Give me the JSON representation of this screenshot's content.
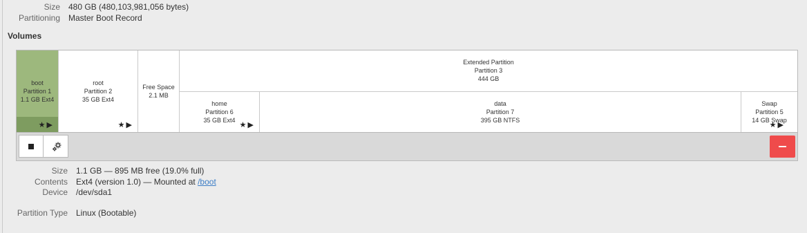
{
  "disk_info": {
    "size_label": "Size",
    "size_value": "480 GB (480,103,981,056 bytes)",
    "partitioning_label": "Partitioning",
    "partitioning_value": "Master Boot Record"
  },
  "volumes": {
    "title": "Volumes",
    "segments": [
      {
        "line1": "boot",
        "line2": "Partition 1",
        "line3": "1.1 GB Ext4",
        "selected": true
      },
      {
        "line1": "root",
        "line2": "Partition 2",
        "line3": "35 GB Ext4"
      },
      {
        "line1": "Free Space",
        "line2": "2.1 MB"
      },
      {
        "line1": "Extended Partition",
        "line2": "Partition 3",
        "line3": "444 GB"
      },
      {
        "line1": "home",
        "line2": "Partition 6",
        "line3": "35 GB Ext4"
      },
      {
        "line1": "data",
        "line2": "Partition 7",
        "line3": "395 GB NTFS"
      },
      {
        "line1": "Swap",
        "line2": "Partition 5",
        "line3": "14 GB Swap"
      }
    ],
    "icons": {
      "star": "★",
      "play": "▶"
    }
  },
  "toolbar": {
    "stop_icon": "stop-icon",
    "gear_icon": "gears-icon",
    "remove_symbol": "−",
    "remove_color": "#ef4b4b"
  },
  "selected_details": {
    "size_label": "Size",
    "size_value": "1.1 GB — 895 MB free (19.0% full)",
    "contents_label": "Contents",
    "contents_value": "Ext4 (version 1.0) — Mounted at ",
    "mount_link": "/boot",
    "device_label": "Device",
    "device_value": "/dev/sda1",
    "partition_type_label": "Partition Type",
    "partition_type_value": "Linux (Bootable)"
  }
}
